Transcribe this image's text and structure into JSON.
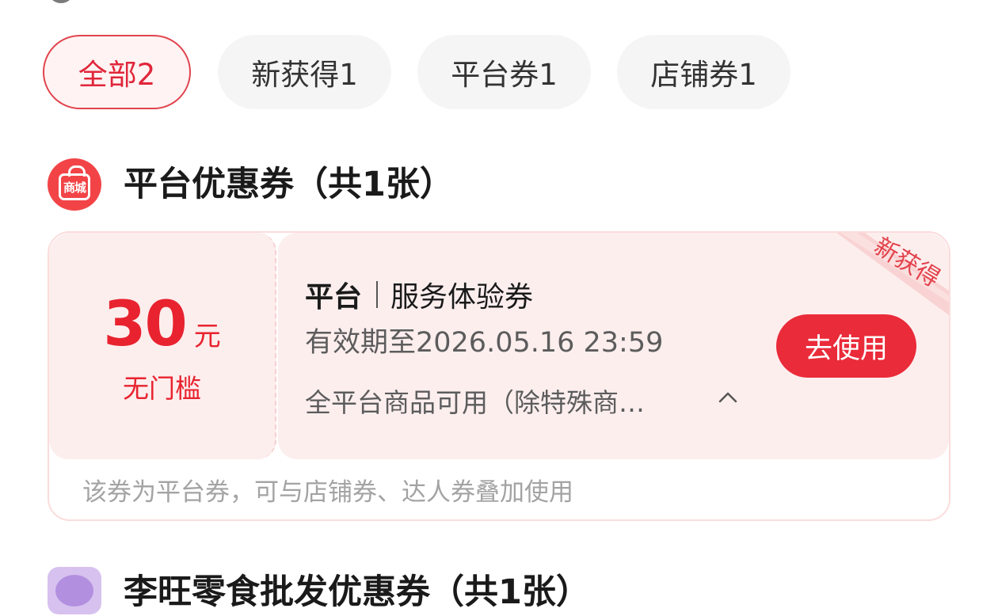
{
  "filters": [
    {
      "label": "全部2",
      "active": true
    },
    {
      "label": "新获得1",
      "active": false
    },
    {
      "label": "平台券1",
      "active": false
    },
    {
      "label": "店铺券1",
      "active": false
    }
  ],
  "section_platform": {
    "icon": "mall-bag-icon",
    "icon_label": "商城",
    "title": "平台优惠券（共1张）"
  },
  "coupon": {
    "amount": "30",
    "unit": "元",
    "threshold": "无门槛",
    "type": "平台",
    "name": "服务体验券",
    "validity": "有效期至2026.05.16 23:59",
    "scope": "全平台商品可用（除特殊商…",
    "use_button": "去使用",
    "ribbon": "新获得",
    "footer_note": "该券为平台券，可与店铺券、达人券叠加使用"
  },
  "section_next": {
    "icon": "shop-logo-icon",
    "title": "李旺零食批发优惠券（共1张）"
  },
  "colors": {
    "accent": "#ea2b3a",
    "price": "#e8232f",
    "card_bg": "#fdeeee",
    "chip_bg": "#f5f5f5"
  }
}
